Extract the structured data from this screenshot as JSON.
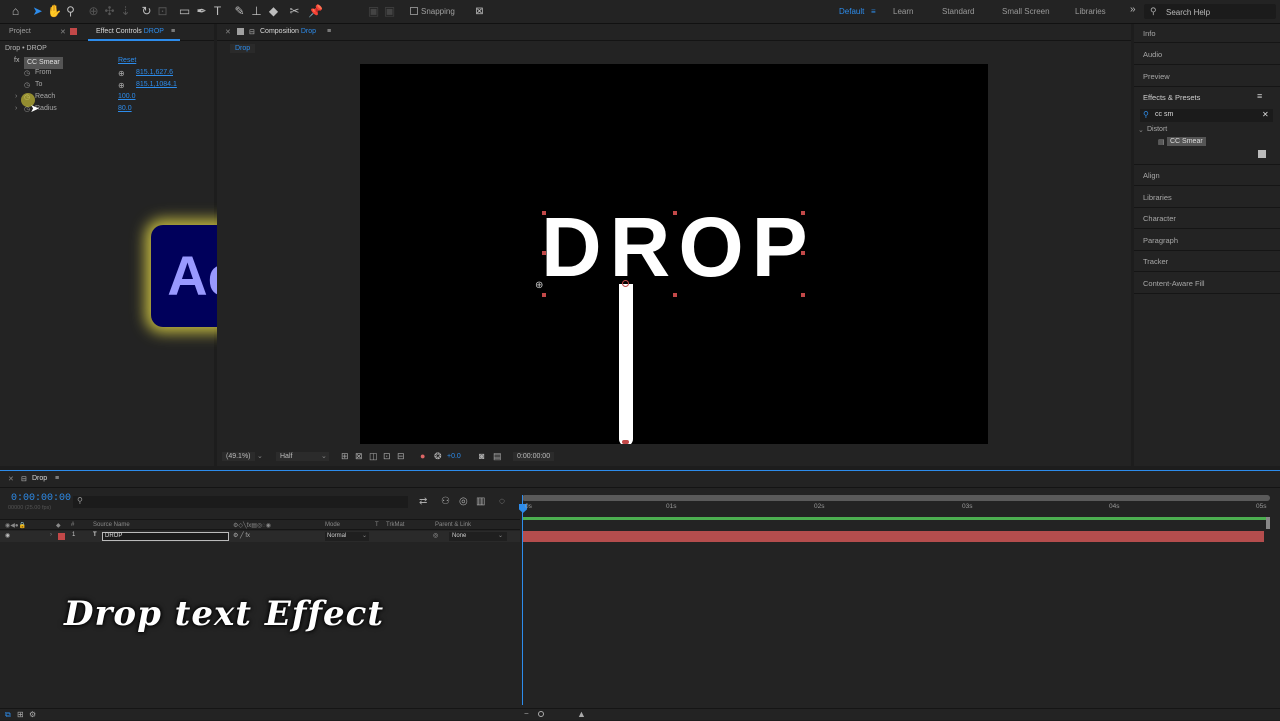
{
  "toolbar": {
    "snapping_label": "Snapping",
    "workspaces": [
      "Default",
      "Learn",
      "Standard",
      "Small Screen",
      "Libraries"
    ],
    "search_placeholder": "Search Help"
  },
  "left_panel": {
    "tab_project": "Project",
    "tab_effect_controls_prefix": "Effect Controls",
    "tab_effect_controls_layer": "DROP",
    "breadcrumb": "Drop • DROP",
    "effect_name": "CC Smear",
    "reset_label": "Reset",
    "properties": [
      {
        "label": "From",
        "value": "815.1,627.6"
      },
      {
        "label": "To",
        "value": "815.1,1084.1"
      },
      {
        "label": "Reach",
        "value": "100.0"
      },
      {
        "label": "Radius",
        "value": "80.0"
      }
    ]
  },
  "composition": {
    "tab_prefix": "Composition",
    "tab_name": "Drop",
    "subtab": "Drop",
    "canvas_text": "DROP",
    "zoom": "(49.1%)",
    "resolution": "Half",
    "exposure": "+0.0",
    "timecode": "0:00:00:00"
  },
  "right_panel": {
    "items_top": [
      "Info",
      "Audio",
      "Preview"
    ],
    "effects_presets": "Effects & Presets",
    "search_value": "cc sm",
    "category": "Distort",
    "result": "CC Smear",
    "items_bottom": [
      "Align",
      "Libraries",
      "Character",
      "Paragraph",
      "Tracker",
      "Content-Aware Fill"
    ]
  },
  "timeline": {
    "tab": "Drop",
    "timecode": "0:00:00:00",
    "frames": "00000 (25.00 fps)",
    "headers": {
      "num": "#",
      "source": "Source Name",
      "mode": "Mode",
      "t": "T",
      "trkmat": "TrkMat",
      "parent": "Parent & Link"
    },
    "layer": {
      "index": "1",
      "type": "T",
      "name": "DROP",
      "mode": "Normal",
      "parent": "None"
    },
    "ruler": [
      "0s",
      "01s",
      "02s",
      "03s",
      "04s",
      "05s"
    ]
  },
  "overlay": {
    "logo_text": "Ae",
    "title": "Drop text Effect"
  },
  "colors": {
    "accent": "#2d8ceb",
    "layer_bar": "#b44d4d",
    "logo_bg": "#00005b",
    "logo_text": "#9999ff",
    "logo_glow": "#f2e64a"
  }
}
